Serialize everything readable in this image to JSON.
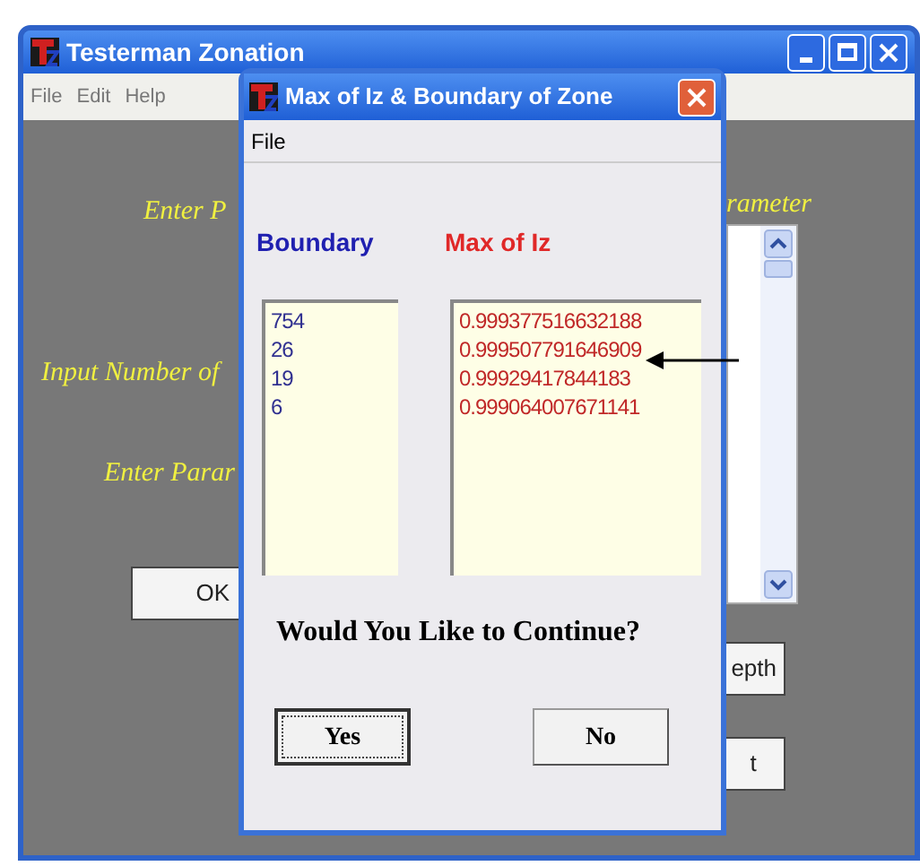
{
  "main_window": {
    "title": "Testerman Zonation",
    "menu": [
      "File",
      "Edit",
      "Help"
    ],
    "labels": [
      "Enter P",
      "rameter",
      "Input Number of",
      "Enter Parar"
    ],
    "buttons": [
      "OK",
      "epth",
      "t"
    ]
  },
  "dialog": {
    "title": "Max of Iz & Boundary of Zone",
    "menu": [
      "File"
    ],
    "columns": [
      {
        "heading": "Boundary",
        "values": [
          "754",
          "26",
          "19",
          "6"
        ]
      },
      {
        "heading": "Max of Iz",
        "values": [
          "0.999377516632188",
          "0.999507791646909",
          "0.99929417844183",
          "0.999064007671141"
        ]
      }
    ],
    "question": "Would You Like to Continue?",
    "buttons": [
      {
        "label": "Yes",
        "focused": true
      },
      {
        "label": "No",
        "focused": false
      }
    ]
  }
}
